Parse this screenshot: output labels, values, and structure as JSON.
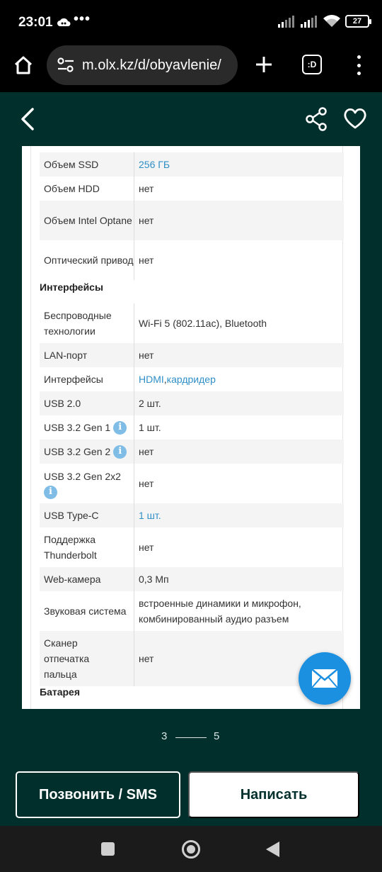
{
  "status": {
    "time": "23:01",
    "dots": "•••",
    "battery": "27"
  },
  "browser": {
    "url": "m.olx.kz/d/obyavlenie/",
    "tabs_label": ":D"
  },
  "specs": {
    "rows1": [
      {
        "key": "Объем SSD",
        "value": "256 ГБ",
        "link": true
      },
      {
        "key": "Объем HDD",
        "value": "нет"
      },
      {
        "key": "Объем Intel Optane",
        "value": "нет"
      },
      {
        "key": "Оптический привод",
        "value": "нет"
      }
    ],
    "section_interfaces": "Интерфейсы",
    "rows2": [
      {
        "key": "Беспроводные технологии",
        "value": "Wi-Fi 5 (802.11ac), Bluetooth"
      },
      {
        "key": "LAN-порт",
        "value": "нет"
      },
      {
        "key": "Интерфейсы",
        "value_link1": "HDMI",
        "value_sep": ", ",
        "value_link2": "кардридер"
      },
      {
        "key": "USB 2.0",
        "value": "2 шт."
      },
      {
        "key": "USB 3.2 Gen 1",
        "value": "1 шт."
      },
      {
        "key": "USB 3.2 Gen 2",
        "value": "нет"
      },
      {
        "key": "USB 3.2 Gen 2x2",
        "value": "нет"
      },
      {
        "key": "USB Type-C",
        "value": "1 шт.",
        "link": true
      },
      {
        "key": "Поддержка Thunderbolt",
        "value": "нет"
      },
      {
        "key": "Web-камера",
        "value": "0,3 Мп"
      },
      {
        "key": "Звуковая система",
        "value": "встроенные динамики и микрофон, комбинированный аудио разъем"
      },
      {
        "key": "Сканер отпечатка пальца",
        "value": "нет"
      }
    ],
    "section_battery": "Батарея",
    "info_glyph": "i"
  },
  "pager": {
    "current": "3",
    "total": "5"
  },
  "actions": {
    "call_label": "Позвонить / SMS",
    "write_label": "Написать"
  }
}
